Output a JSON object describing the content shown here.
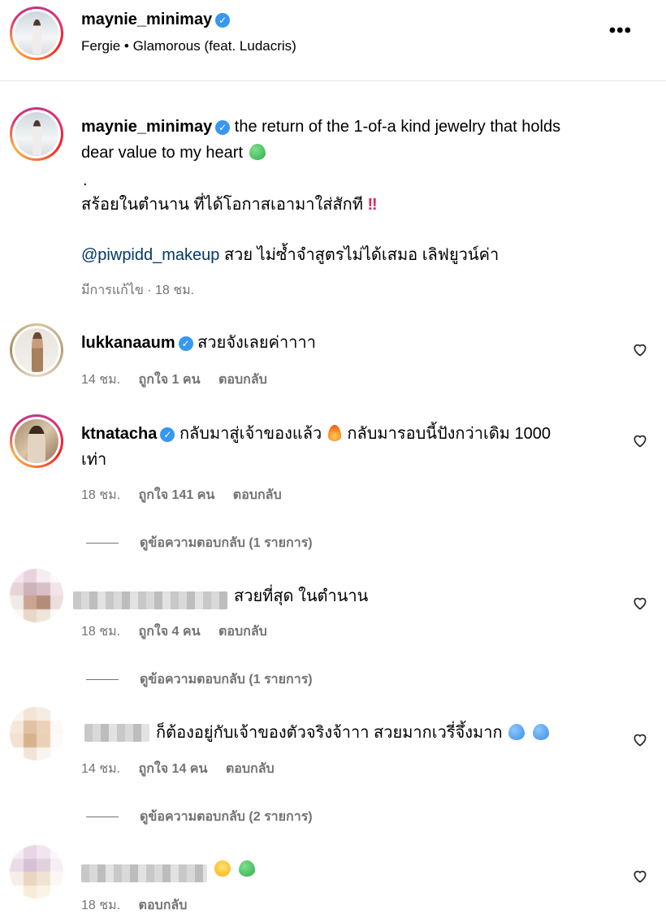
{
  "header": {
    "username": "maynie_minimay",
    "song": "Fergie • Glamorous (feat. Ludacris)",
    "more_label": "•••"
  },
  "caption": {
    "username": "maynie_minimay",
    "text_line1": "the return of the 1-of-a kind jewelry that holds",
    "text_line2": "dear value to my heart",
    "dot": ".",
    "thai_line": "สร้อยในตำนาน ที่ได้โอกาสเอามาใส่สักที",
    "mention": "@piwpidd_makeup",
    "mention_text": "สวย ไม่ซ้ำจำสูตรไม่ได้เสมอ เลิฟยูวน์ค่า",
    "meta": "มีการแก้ไข · 18 ชม."
  },
  "comments": [
    {
      "username": "lukkanaaum",
      "verified": true,
      "text": "สวยจังเลยค่าาาา",
      "time": "14 ชม.",
      "likes": "ถูกใจ 1 คน",
      "reply": "ตอบกลับ"
    },
    {
      "username": "ktnatacha",
      "verified": true,
      "text_line1": "กลับมาสู่เจ้าของแล้ว",
      "text_line1b": "กลับมารอบนี้ปังกว่าเดิม 1000",
      "text_line2": "เท่า",
      "time": "18 ชม.",
      "likes": "ถูกใจ 141 คน",
      "reply": "ตอบกลับ",
      "view_replies": "ดูข้อความตอบกลับ (1 รายการ)"
    },
    {
      "username": "",
      "text": "สวยที่สุด ในตำนาน",
      "time": "18 ชม.",
      "likes": "ถูกใจ 4 คน",
      "reply": "ตอบกลับ",
      "view_replies": "ดูข้อความตอบกลับ (1 รายการ)"
    },
    {
      "username": "",
      "text": "ก็ต้องอยู่กับเจ้าของตัวจริงจ้าาา สวยมากเวรี่จึ้งมาก",
      "time": "14 ชม.",
      "likes": "ถูกใจ 14 คน",
      "reply": "ตอบกลับ",
      "view_replies": "ดูข้อความตอบกลับ (2 รายการ)"
    },
    {
      "username": "",
      "text": "",
      "time": "18 ชม.",
      "reply": "ตอบกลับ"
    }
  ],
  "icons": {
    "verified": "verified-badge-icon",
    "heart": "heart-outline-icon",
    "more": "more-horizontal-icon"
  },
  "colors": {
    "verified": "#3897f0",
    "mention": "#00376b",
    "meta": "#737373"
  }
}
